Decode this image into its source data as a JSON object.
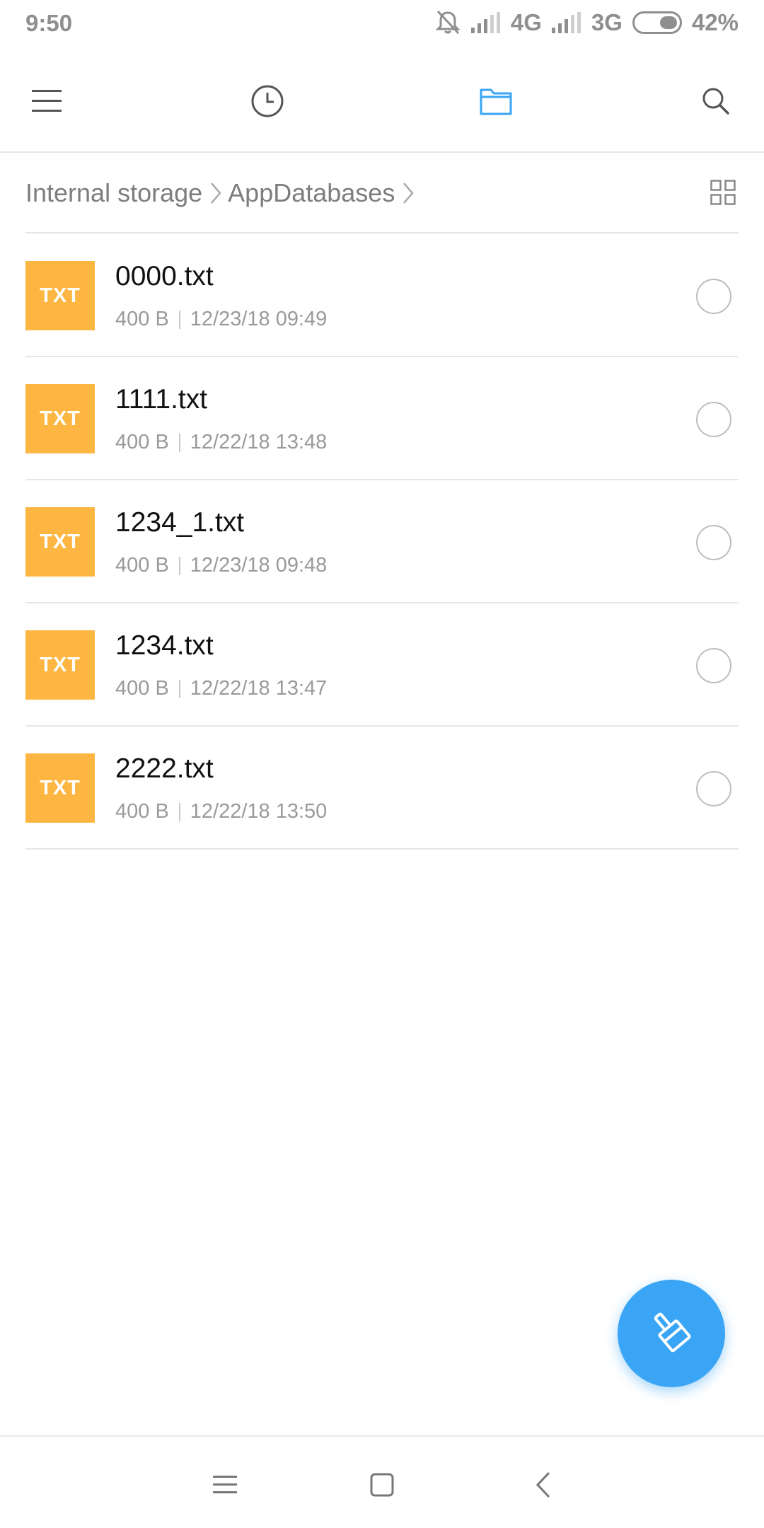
{
  "status_bar": {
    "time": "9:50",
    "network_1": "4G",
    "network_2": "3G",
    "battery": "42%"
  },
  "toolbar": {
    "icons": [
      "menu-icon",
      "recent-clock-icon",
      "folder-icon",
      "search-icon"
    ],
    "active_tab": "folder",
    "accent_color": "#3aa5f5"
  },
  "breadcrumb": {
    "items": [
      "Internal storage",
      "AppDatabases"
    ]
  },
  "files": [
    {
      "icon_label": "TXT",
      "name": "0000.txt",
      "size": "400 B",
      "date": "12/23/18 09:49"
    },
    {
      "icon_label": "TXT",
      "name": "1111.txt",
      "size": "400 B",
      "date": "12/22/18 13:48"
    },
    {
      "icon_label": "TXT",
      "name": "1234_1.txt",
      "size": "400 B",
      "date": "12/23/18 09:48"
    },
    {
      "icon_label": "TXT",
      "name": "1234.txt",
      "size": "400 B",
      "date": "12/22/18 13:47"
    },
    {
      "icon_label": "TXT",
      "name": "2222.txt",
      "size": "400 B",
      "date": "12/22/18 13:50"
    }
  ],
  "colors": {
    "txt_icon": "#fdb641",
    "fab": "#3aa5f5"
  },
  "fab": {
    "icon": "cleaner-brush-icon"
  },
  "nav_bar": {
    "icons": [
      "recents-menu-icon",
      "home-square-icon",
      "back-chevron-icon"
    ]
  }
}
